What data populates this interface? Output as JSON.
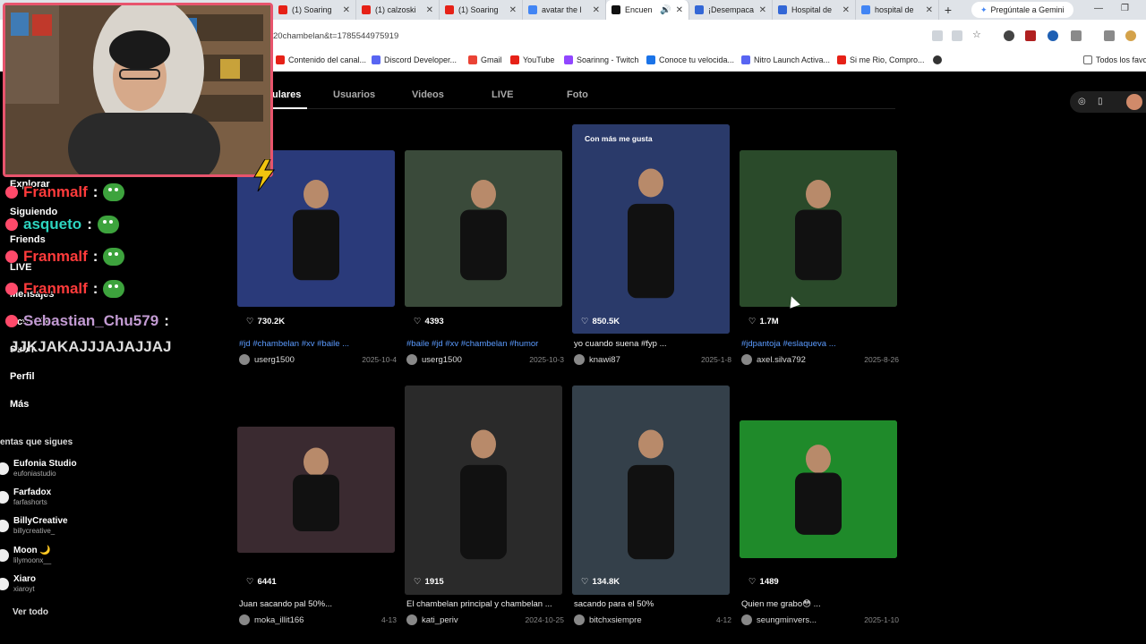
{
  "browser": {
    "tabs": [
      {
        "title": "(1) Soaring",
        "fav": "#e62117"
      },
      {
        "title": "(1) calzoski",
        "fav": "#e62117"
      },
      {
        "title": "(1) Soaring",
        "fav": "#e62117"
      },
      {
        "title": "avatar the l",
        "fav": "#4285f4"
      },
      {
        "title": "Encuen",
        "fav": "#111111",
        "active": true
      },
      {
        "title": "¡Desempaca",
        "fav": "#3367d6"
      },
      {
        "title": "Hospital de",
        "fav": "#3367d6"
      },
      {
        "title": "hospital de",
        "fav": "#4285f4"
      }
    ],
    "gemini_label": "Pregúntale a Gemini",
    "url": "20chambelan&t=1785544975919",
    "bookmarks": [
      {
        "label": "Contenido del canal...",
        "color": "#e62117"
      },
      {
        "label": "Discord Developer...",
        "color": "#5865f2"
      },
      {
        "label": "Gmail",
        "color": "#ea4335"
      },
      {
        "label": "YouTube",
        "color": "#e62117"
      },
      {
        "label": "Soarinng - Twitch",
        "color": "#9146ff"
      },
      {
        "label": "Conoce tu velocida...",
        "color": "#1a73e8"
      },
      {
        "label": "Nitro Launch Activa...",
        "color": "#5865f2"
      },
      {
        "label": "Si me Rio, Compro...",
        "color": "#e62117"
      }
    ],
    "bookmarks_right": "Todos los favo"
  },
  "tiktok": {
    "subtabs": [
      "ulares",
      "Usuarios",
      "Videos",
      "LIVE",
      "Foto"
    ],
    "nav": [
      "Explorar",
      "Siguiendo",
      "Friends",
      "LIVE",
      "Mensajes",
      "Actividad",
      "Subir",
      "Perfil",
      "Más"
    ],
    "following_title": "entas que sigues",
    "accounts": [
      {
        "name": "Eufonia Studio",
        "handle": "eufoniastudio"
      },
      {
        "name": "Farfadox",
        "handle": "farfashorts"
      },
      {
        "name": "BillyCreative",
        "handle": "billycreative_"
      },
      {
        "name": "Moon 🌙",
        "handle": "lilymoonx__"
      },
      {
        "name": "Xiaro",
        "handle": "xiaroyt"
      }
    ],
    "ver_todo": "Ver todo",
    "videos": [
      {
        "likes": "730.2K",
        "desc": "#jd #chambelan #xv #baile ...",
        "tags": true,
        "author": "userg1500",
        "date": "2025-10-4",
        "bg": "#2a3a7a"
      },
      {
        "likes": "4393",
        "desc": "#baile #jd #xv #chambelan #humor",
        "tags": true,
        "author": "userg1500",
        "date": "2025-10-3",
        "bg": "#3a4a3a"
      },
      {
        "likes": "850.5K",
        "desc": "yo cuando suena #fyp ...",
        "tags": false,
        "author": "knawi87",
        "date": "2025-1-8",
        "bg": "#2a3a6a",
        "badge": "Con más me gusta"
      },
      {
        "likes": "1.7M",
        "desc": "#jdpantoja #eslaqueva ...",
        "tags": true,
        "author": "axel.silva792",
        "date": "2025-8-26",
        "bg": "#2a4a2a"
      },
      {
        "likes": "6441",
        "desc": "Juan sacando pal 50%...",
        "tags": false,
        "author": "moka_illit166",
        "date": "4-13",
        "bg": "#3a2a30"
      },
      {
        "likes": "1915",
        "desc": "El chambelan principal y chambelan ...",
        "tags": false,
        "author": "kati_periv",
        "date": "2024-10-25",
        "bg": "#2a2a2a"
      },
      {
        "likes": "134.8K",
        "desc": "sacando para el 50%",
        "tags": false,
        "author": "bitchxsiempre",
        "date": "4-12",
        "bg": "#34404a"
      },
      {
        "likes": "1489",
        "desc": "Quien me grabo😳 ...",
        "tags": false,
        "author": "seungminvers...",
        "date": "2025-1-10",
        "bg": "#1f8a2a"
      }
    ]
  },
  "chat": {
    "messages": [
      {
        "user": "Franmalf",
        "color": "#ff3b3b"
      },
      {
        "user": "asqueto",
        "color": "#2dd4bf"
      },
      {
        "user": "Franmalf",
        "color": "#ff3b3b"
      },
      {
        "user": "Franmalf",
        "color": "#ff3b3b"
      },
      {
        "user": "Sebastian_Chu579",
        "color": "#c39bd3"
      }
    ],
    "last_text": "JJKJAKAJJJAJAJJAJ"
  }
}
